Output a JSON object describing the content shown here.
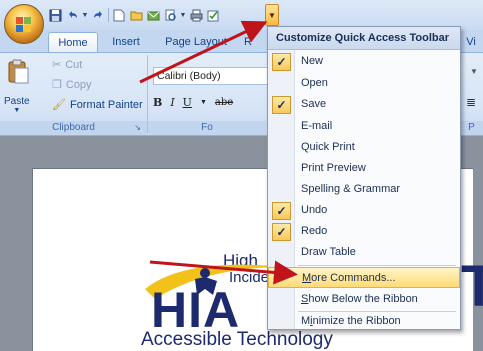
{
  "qat": {
    "icons": [
      "save-icon",
      "undo-icon",
      "redo-icon",
      "new-icon",
      "open-icon",
      "email-icon",
      "print-preview-icon",
      "quick-print-icon",
      "spelling-icon"
    ],
    "dropdown_icon": "customize-dropdown-icon"
  },
  "tabs": [
    "Home",
    "Insert",
    "Page Layout",
    "R",
    "Vi"
  ],
  "clipboard": {
    "paste": "Paste",
    "cut": "Cut",
    "copy": "Copy",
    "format_painter": "Format Painter",
    "group_label": "Clipboard"
  },
  "font": {
    "font_name": "Calibri (Body)",
    "bold": "B",
    "italic": "I",
    "underline": "U",
    "strike": "abe",
    "group_label": "Fo"
  },
  "paragraph": {
    "group_label": "P"
  },
  "menu": {
    "title": "Customize Quick Access Toolbar",
    "items": [
      {
        "label": "New",
        "checked": true
      },
      {
        "label": "Open",
        "checked": false
      },
      {
        "label": "Save",
        "checked": true
      },
      {
        "label": "E-mail",
        "checked": false
      },
      {
        "label": "Quick Print",
        "checked": false
      },
      {
        "label": "Print Preview",
        "checked": false
      },
      {
        "label": "Spelling & Grammar",
        "checked": false
      },
      {
        "label": "Undo",
        "checked": true
      },
      {
        "label": "Redo",
        "checked": true
      },
      {
        "label": "Draw Table",
        "checked": false
      }
    ],
    "more_commands": "More Commands...",
    "show_below": "Show Below the Ribbon",
    "minimize": "Minimize the Ribbon"
  },
  "document": {
    "logo_high": "High",
    "logo_incide": "Incide",
    "logo_hia": "HIA",
    "logo_t": "T",
    "logo_tagline": "Accessible Technology"
  },
  "colors": {
    "accent_orange": "#ffb840",
    "ribbon_blue": "#d6e4f6",
    "text_blue": "#15428b",
    "arrow_red": "#c0141b",
    "logo_navy": "#1d2a6e",
    "logo_gold": "#f2c21b"
  }
}
